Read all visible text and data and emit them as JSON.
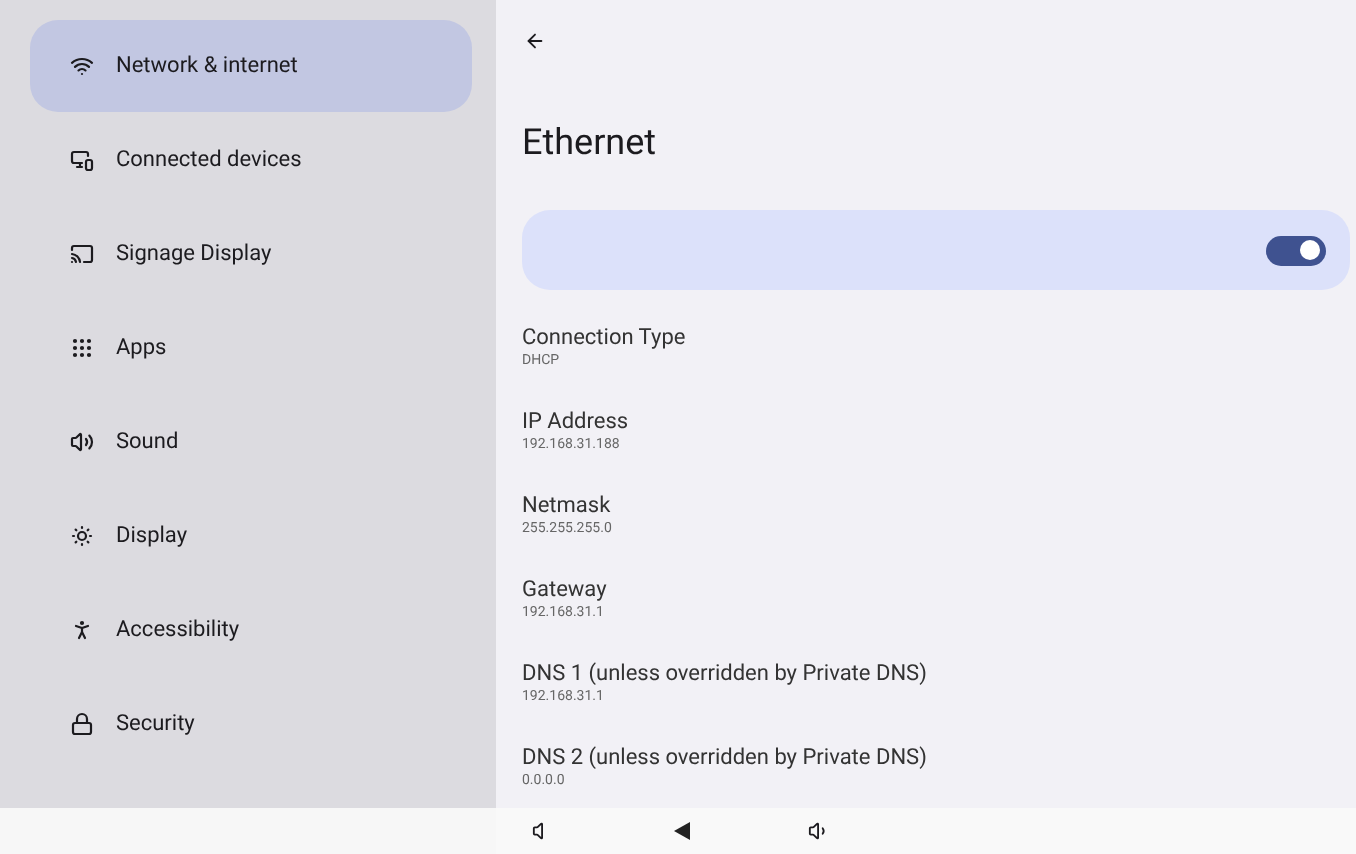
{
  "sidebar": {
    "items": [
      {
        "label": "Network & internet",
        "selected": true
      },
      {
        "label": "Connected devices",
        "selected": false
      },
      {
        "label": "Signage Display",
        "selected": false
      },
      {
        "label": "Apps",
        "selected": false
      },
      {
        "label": "Sound",
        "selected": false
      },
      {
        "label": "Display",
        "selected": false
      },
      {
        "label": "Accessibility",
        "selected": false
      },
      {
        "label": "Security",
        "selected": false
      }
    ]
  },
  "page": {
    "title": "Ethernet",
    "toggle": {
      "on": true
    },
    "details": [
      {
        "label": "Connection Type",
        "value": "DHCP"
      },
      {
        "label": "IP Address",
        "value": "192.168.31.188"
      },
      {
        "label": "Netmask",
        "value": "255.255.255.0"
      },
      {
        "label": "Gateway",
        "value": "192.168.31.1"
      },
      {
        "label": "DNS 1 (unless overridden by Private DNS)",
        "value": "192.168.31.1"
      },
      {
        "label": "DNS 2 (unless overridden by Private DNS)",
        "value": "0.0.0.0"
      }
    ]
  }
}
